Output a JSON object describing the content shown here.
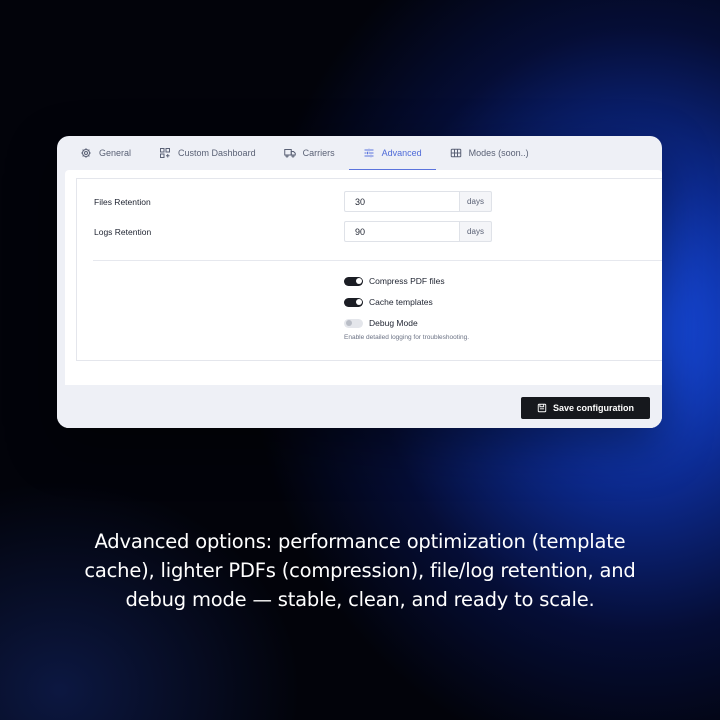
{
  "tabs": [
    {
      "label": "General",
      "icon": "gear-icon",
      "active": false
    },
    {
      "label": "Custom Dashboard",
      "icon": "dashboard-icon",
      "active": false
    },
    {
      "label": "Carriers",
      "icon": "truck-icon",
      "active": false
    },
    {
      "label": "Advanced",
      "icon": "sliders-icon",
      "active": true
    },
    {
      "label": "Modes (soon..)",
      "icon": "table-icon",
      "active": false
    }
  ],
  "settings": {
    "files_retention": {
      "label": "Files Retention",
      "value": "30",
      "unit": "days"
    },
    "logs_retention": {
      "label": "Logs Retention",
      "value": "90",
      "unit": "days"
    }
  },
  "toggles": [
    {
      "label": "Compress PDF files",
      "on": true
    },
    {
      "label": "Cache templates",
      "on": true
    },
    {
      "label": "Debug Mode",
      "on": false,
      "help": "Enable detailed logging for troubleshooting."
    }
  ],
  "footer": {
    "save_label": "Save configuration"
  },
  "caption": "Advanced options: performance optimization (template cache), lighter PDFs (compression), file/log retention, and debug mode — stable, clean, and ready to scale.",
  "colors": {
    "accent": "#5b74dd",
    "button": "#16181d",
    "switch_on": "#1b1d24"
  }
}
